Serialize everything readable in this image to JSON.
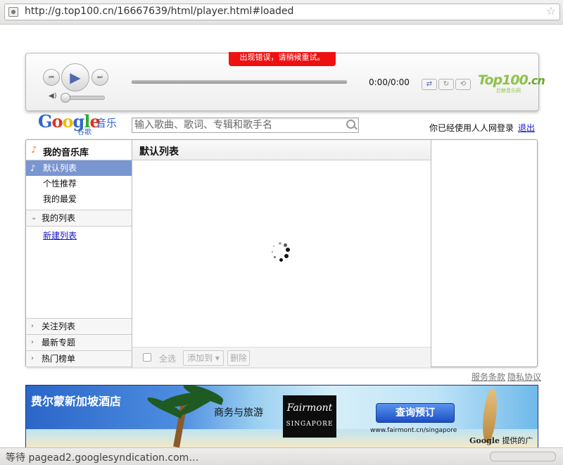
{
  "browser": {
    "url": "http://g.top100.cn/16667639/html/player.html#loaded"
  },
  "player": {
    "error_message": "出现错误，请稍候重试。",
    "time": "0:00/0:00",
    "volume_level": 0,
    "brand": "Top100",
    "brand_suffix": ".cn",
    "brand_sub": "巨鲸音乐网"
  },
  "header": {
    "logo_letters": [
      "G",
      "o",
      "o",
      "g",
      "l",
      "e"
    ],
    "logo_sub": "谷歌",
    "music_label": "音乐",
    "search_placeholder": "输入歌曲、歌词、专辑和歌手名",
    "login_status": "你已经使用人人网登录",
    "logout": "退出"
  },
  "sidebar": {
    "library_title": "我的音乐库",
    "items": [
      {
        "label": "默认列表",
        "selected": true
      },
      {
        "label": "个性推荐"
      },
      {
        "label": "我的最爱"
      }
    ],
    "my_lists": "我的列表",
    "new_list": "新建列表",
    "bottom_sections": [
      "关注列表",
      "最新专题",
      "热门榜单"
    ]
  },
  "main": {
    "title": "默认列表",
    "select_all": "全选",
    "add_to": "添加到",
    "delete": "删除"
  },
  "footer": {
    "terms": "服务条款",
    "privacy": "隐私协议"
  },
  "ad": {
    "title": "费尔蒙新加坡酒店",
    "tagline": "商务与旅游",
    "logo_line1": "Fairmont",
    "logo_line2": "SINGAPORE",
    "button": "查询预订",
    "url": "www.fairmont.cn/singapore",
    "by_brand": "Google",
    "by_text": "提供的广告"
  },
  "status_bar": {
    "text": "等待 pagead2.googlesyndication.com…"
  },
  "colors": {
    "selected_row": "#7a96d1",
    "error_bg": "#ee1111",
    "link": "#1515cc"
  }
}
